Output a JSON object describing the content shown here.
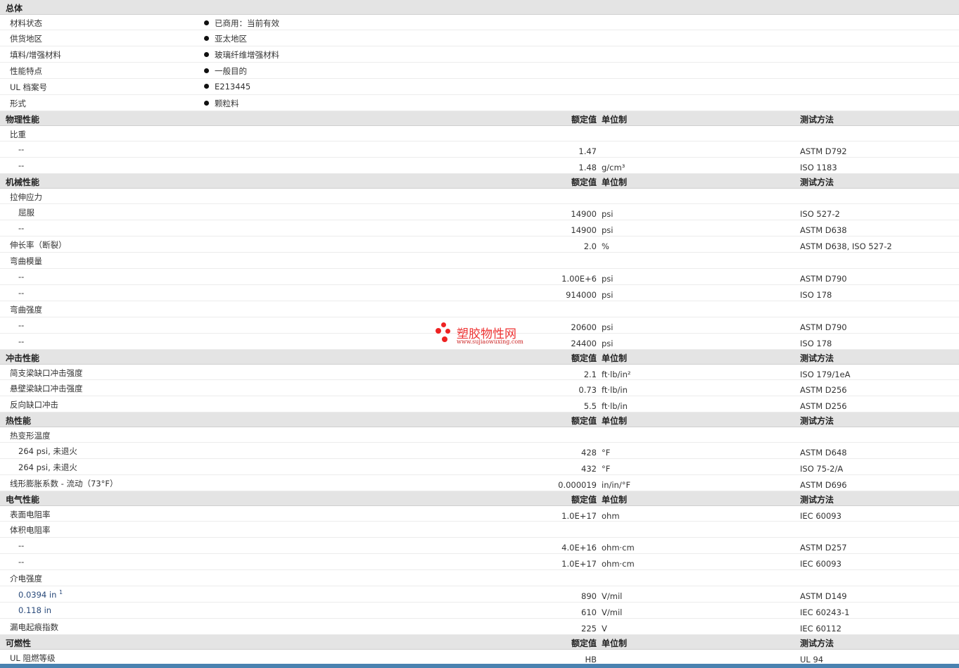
{
  "sections": [
    {
      "title": "总体",
      "kind": "general",
      "rows": [
        {
          "label": "材料状态",
          "bullet": "已商用：当前有效"
        },
        {
          "label": "供货地区",
          "bullet": "亚太地区"
        },
        {
          "label": "填料/增强材料",
          "bullet": "玻璃纤维增强材料"
        },
        {
          "label": "性能特点",
          "bullet": "一般目的"
        },
        {
          "label": "UL 档案号",
          "bullet": "E213445"
        },
        {
          "label": "形式",
          "bullet": "颗粒料"
        }
      ]
    },
    {
      "title": "物理性能",
      "kind": "table",
      "rows": [
        {
          "label": "比重"
        },
        {
          "label": "--",
          "sub": true,
          "value": "1.47",
          "unit": "",
          "method": "ASTM D792"
        },
        {
          "label": "--",
          "sub": true,
          "value": "1.48",
          "unit": "g/cm³",
          "method": "ISO 1183"
        }
      ]
    },
    {
      "title": "机械性能",
      "kind": "table",
      "rows": [
        {
          "label": "拉伸应力"
        },
        {
          "label": "屈服",
          "sub": true,
          "value": "14900",
          "unit": "psi",
          "method": "ISO 527-2"
        },
        {
          "label": "--",
          "sub": true,
          "value": "14900",
          "unit": "psi",
          "method": "ASTM D638"
        },
        {
          "label": "伸长率（断裂）",
          "value": "2.0",
          "unit": "%",
          "method": "ASTM D638, ISO 527-2"
        },
        {
          "label": "弯曲模量"
        },
        {
          "label": "--",
          "sub": true,
          "value": "1.00E+6",
          "unit": "psi",
          "method": "ASTM D790"
        },
        {
          "label": "--",
          "sub": true,
          "value": "914000",
          "unit": "psi",
          "method": "ISO 178"
        },
        {
          "label": "弯曲强度"
        },
        {
          "label": "--",
          "sub": true,
          "value": "20600",
          "unit": "psi",
          "method": "ASTM D790"
        },
        {
          "label": "--",
          "sub": true,
          "value": "24400",
          "unit": "psi",
          "method": "ISO 178"
        }
      ]
    },
    {
      "title": "冲击性能",
      "kind": "table",
      "rows": [
        {
          "label": "简支梁缺口冲击强度",
          "value": "2.1",
          "unit": "ft·lb/in²",
          "method": "ISO 179/1eA"
        },
        {
          "label": "悬壁梁缺口冲击强度",
          "value": "0.73",
          "unit": "ft·lb/in",
          "method": "ASTM D256"
        },
        {
          "label": "反向缺口冲击",
          "value": "5.5",
          "unit": "ft·lb/in",
          "method": "ASTM D256"
        }
      ]
    },
    {
      "title": "热性能",
      "kind": "table",
      "rows": [
        {
          "label": "热变形温度"
        },
        {
          "label": "264 psi, 未退火",
          "sub": true,
          "value": "428",
          "unit": "°F",
          "method": "ASTM D648"
        },
        {
          "label": "264 psi, 未退火",
          "sub": true,
          "value": "432",
          "unit": "°F",
          "method": "ISO 75-2/A"
        },
        {
          "label": "线形膨胀系数 - 流动（73°F）",
          "value": "0.000019",
          "unit": "in/in/°F",
          "method": "ASTM D696"
        }
      ]
    },
    {
      "title": "电气性能",
      "kind": "table",
      "rows": [
        {
          "label": "表面电阻率",
          "value": "1.0E+17",
          "unit": "ohm",
          "method": "IEC 60093"
        },
        {
          "label": "体积电阻率"
        },
        {
          "label": "--",
          "sub": true,
          "value": "4.0E+16",
          "unit": "ohm·cm",
          "method": "ASTM D257"
        },
        {
          "label": "--",
          "sub": true,
          "value": "1.0E+17",
          "unit": "ohm·cm",
          "method": "IEC 60093"
        },
        {
          "label": "介电强度"
        },
        {
          "label": "0.0394 in",
          "sup": "1",
          "sub": true,
          "blue": true,
          "value": "890",
          "unit": "V/mil",
          "method": "ASTM D149"
        },
        {
          "label": "0.118 in",
          "sub": true,
          "blue": true,
          "value": "610",
          "unit": "V/mil",
          "method": "IEC 60243-1"
        },
        {
          "label": "漏电起痕指数",
          "value": "225",
          "unit": "V",
          "method": "IEC 60112"
        }
      ]
    },
    {
      "title": "可燃性",
      "kind": "table",
      "rows": [
        {
          "label": "UL 阻燃等级",
          "value": "HB",
          "unit": "",
          "method": "UL 94"
        }
      ]
    }
  ],
  "columns": {
    "value": "额定值",
    "unit": "单位制",
    "method": "测试方法"
  },
  "watermark": {
    "name": "塑胶物性网",
    "url": "www.sujiaowuxing.com",
    "color": "#e22222"
  }
}
